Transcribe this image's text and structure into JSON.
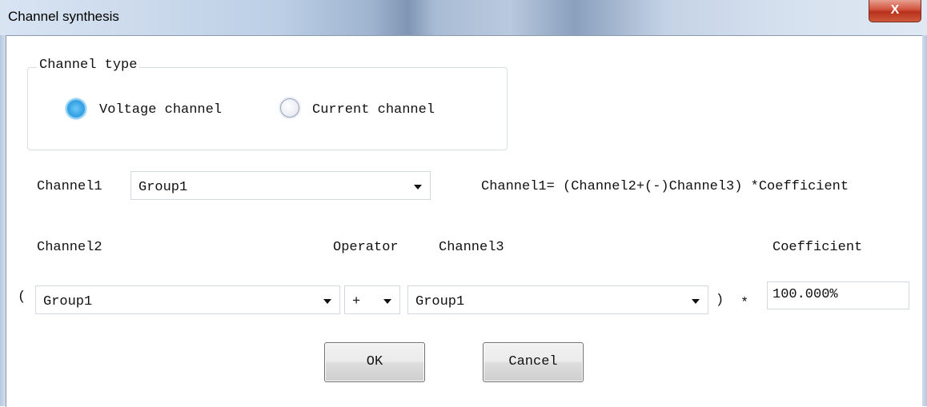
{
  "window": {
    "title": "Channel synthesis",
    "close_label": "X"
  },
  "channel_type": {
    "legend": "Channel type",
    "options": [
      {
        "label": "Voltage channel",
        "selected": true
      },
      {
        "label": "Current channel",
        "selected": false
      }
    ]
  },
  "channel1": {
    "label": "Channel1",
    "value": "Group1"
  },
  "formula": "Channel1= (Channel2+(-)Channel3) *Coefficient",
  "headers": {
    "channel2": "Channel2",
    "operator": "Operator",
    "channel3": "Channel3",
    "coefficient": "Coefficient"
  },
  "expression": {
    "open_paren": "(",
    "channel2_value": "Group1",
    "operator_value": "+",
    "channel3_value": "Group1",
    "close_paren": ")",
    "multiply": "*",
    "coefficient_value": "100.000%"
  },
  "buttons": {
    "ok": "OK",
    "cancel": "Cancel"
  }
}
